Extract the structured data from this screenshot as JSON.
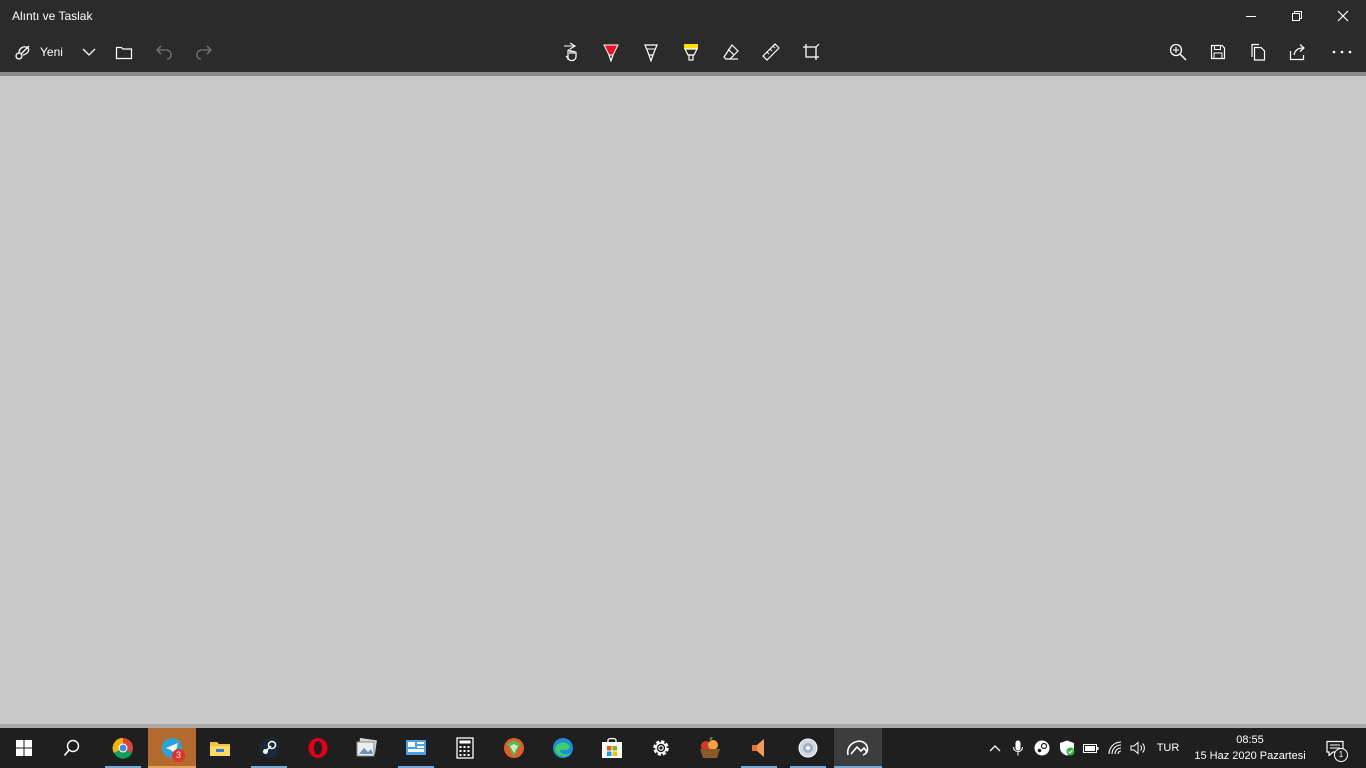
{
  "window": {
    "title": "Alıntı ve Taslak"
  },
  "toolbar": {
    "new_label": "Yeni",
    "accent_active_tool": "#5aa0e6",
    "highlighter_color": "#ffe000",
    "ballpoint_color": "#e81123"
  },
  "taskbar": {
    "telegram_badge": "3",
    "tray_language": "TUR",
    "clock_time": "08:55",
    "clock_date": "15 Haz 2020 Pazartesi",
    "notification_count": "1"
  }
}
